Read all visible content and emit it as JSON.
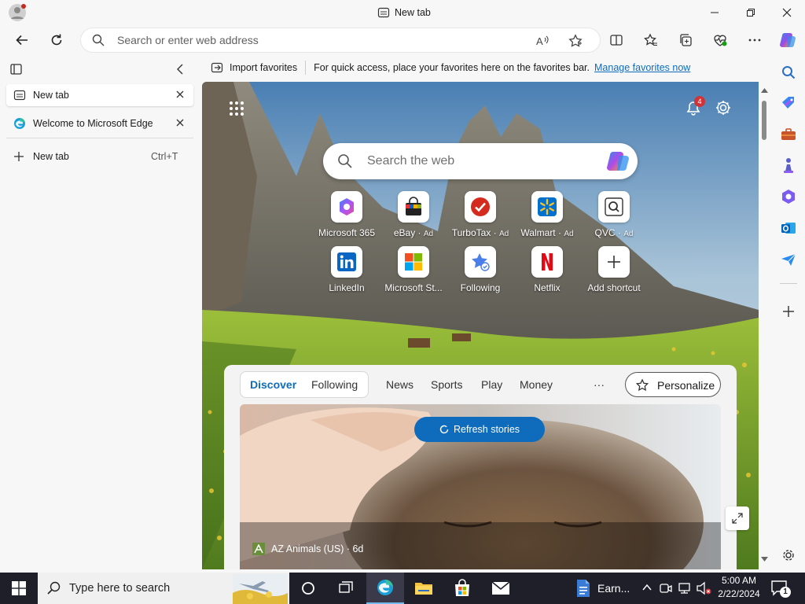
{
  "window": {
    "tab_title": "New tab"
  },
  "toolbar": {
    "address_placeholder": "Search or enter web address"
  },
  "favorites_bar": {
    "import_label": "Import favorites",
    "message": "For quick access, place your favorites here on the favorites bar.",
    "manage_link": "Manage favorites now"
  },
  "vertical_tabs": {
    "tabs": [
      {
        "label": "New tab",
        "active": true
      },
      {
        "label": "Welcome to Microsoft Edge",
        "active": false
      }
    ],
    "new_tab": {
      "label": "New tab",
      "shortcut": "Ctrl+T"
    }
  },
  "newtab_page": {
    "search_placeholder": "Search the web",
    "notification_count": "4",
    "shortcuts_row1": [
      {
        "label": "Microsoft 365",
        "ad": ""
      },
      {
        "label": "eBay",
        "ad": "Ad"
      },
      {
        "label": "TurboTax",
        "ad": "Ad"
      },
      {
        "label": "Walmart",
        "ad": "Ad"
      },
      {
        "label": "QVC",
        "ad": "Ad"
      }
    ],
    "shortcuts_row2": [
      {
        "label": "LinkedIn",
        "ad": ""
      },
      {
        "label": "Microsoft St...",
        "ad": ""
      },
      {
        "label": "Following",
        "ad": ""
      },
      {
        "label": "Netflix",
        "ad": ""
      },
      {
        "label": "Add shortcut",
        "ad": ""
      }
    ],
    "feed": {
      "tabs": [
        "Discover",
        "Following",
        "News",
        "Sports",
        "Play",
        "Money"
      ],
      "more": "···",
      "personalize": "Personalize",
      "refresh": "Refresh stories",
      "story_source": "AZ Animals (US) · 6d"
    }
  },
  "taskbar": {
    "search_placeholder": "Type here to search",
    "app_label": "Earn...",
    "time": "5:00 AM",
    "date": "2/22/2024",
    "notification_count": "1"
  },
  "colors": {
    "accent": "#0f6cbd",
    "link": "#0f6cbd",
    "taskbar": "#1f1f2a"
  }
}
